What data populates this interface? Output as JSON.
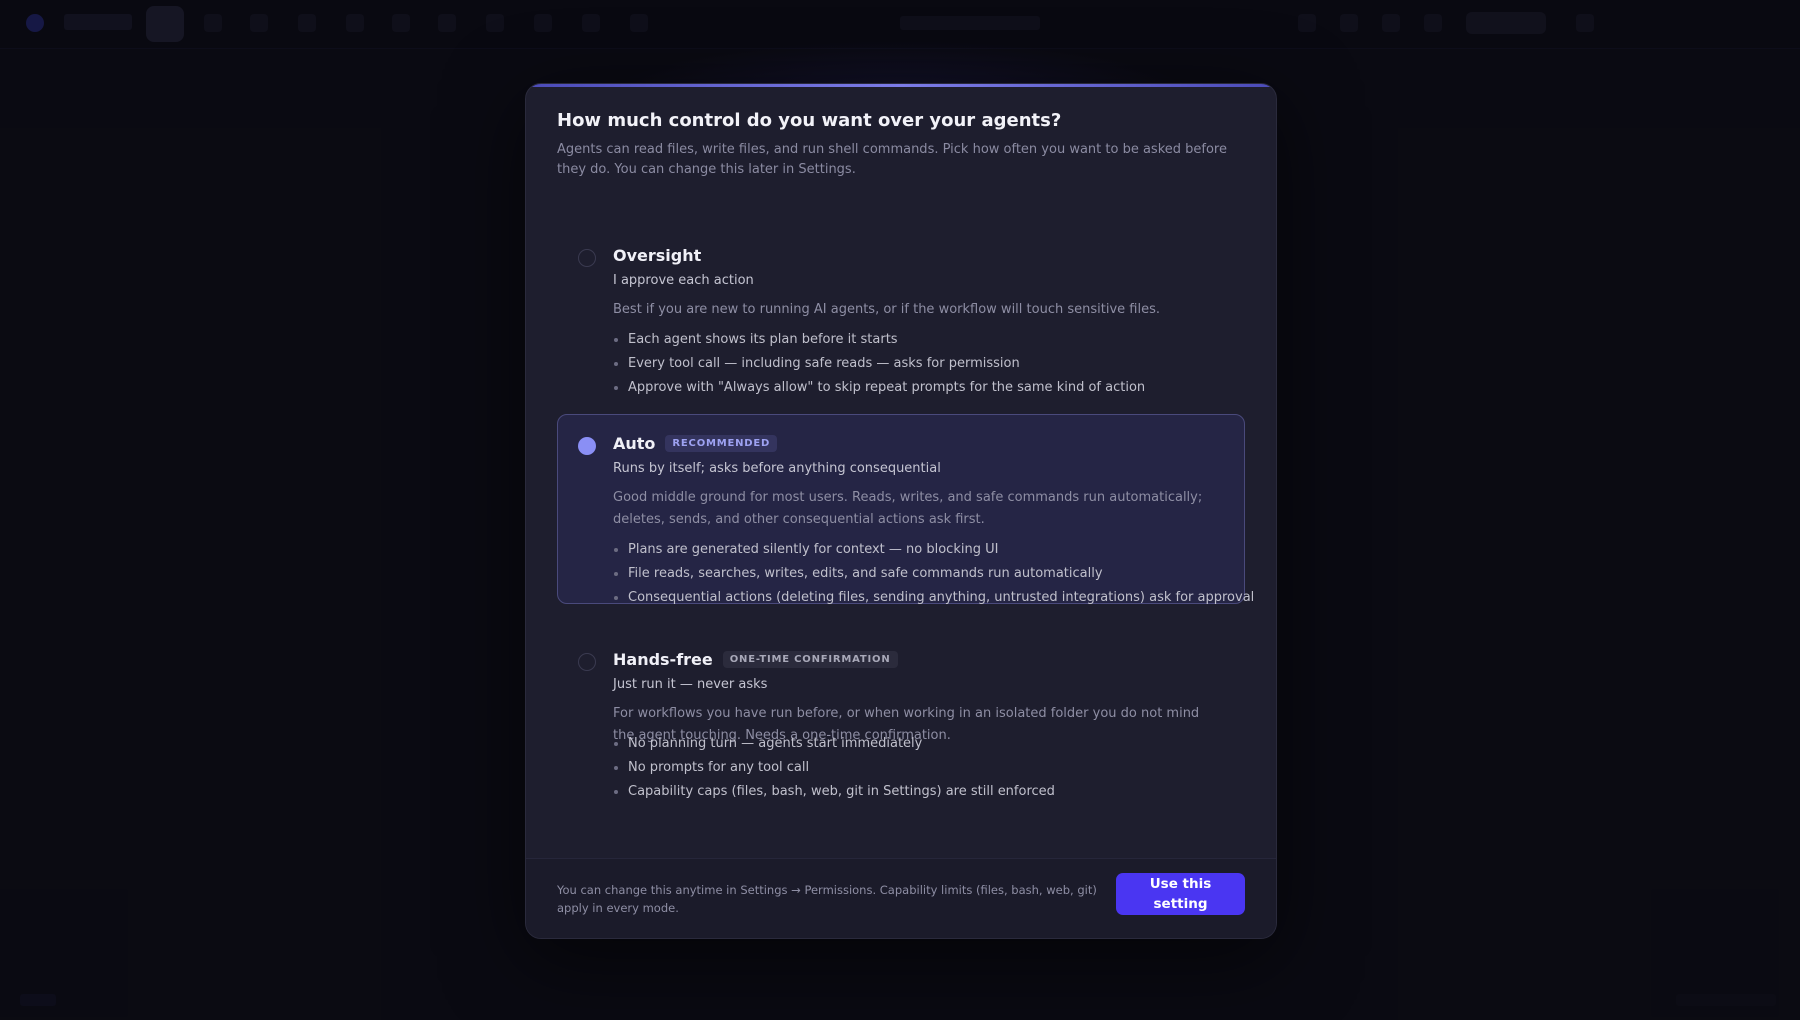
{
  "dialog": {
    "title": "How much control do you want over your agents?",
    "subtitle": "Agents can read files, write files, and run shell commands. Pick how often you want to be asked before they do. You can change this later in Settings."
  },
  "options": [
    {
      "name": "Oversight",
      "badge": "",
      "selected": false,
      "tagline": "I approve each action",
      "description": "Best if you are new to running AI agents, or if the workflow will touch sensitive files.",
      "bullets": [
        "Each agent shows its plan before it starts",
        "Every tool call — including safe reads — asks for permission",
        "Approve with \"Always allow\" to skip repeat prompts for the same kind of action"
      ]
    },
    {
      "name": "Auto",
      "badge": "RECOMMENDED",
      "selected": true,
      "tagline": "Runs by itself; asks before anything consequential",
      "description": "Good middle ground for most users. Reads, writes, and safe commands run automatically; deletes, sends, and other consequential actions ask first.",
      "bullets": [
        "Plans are generated silently for context — no blocking UI",
        "File reads, searches, writes, edits, and safe commands run automatically",
        "Consequential actions (deleting files, sending anything, untrusted integrations) ask for approval"
      ]
    },
    {
      "name": "Hands-free",
      "badge": "ONE-TIME CONFIRMATION",
      "selected": false,
      "tagline": "Just run it — never asks",
      "description": "For workflows you have run before, or when working in an isolated folder you do not mind the agent touching. Needs a one-time confirmation.",
      "bullets": [
        "No planning turn — agents start immediately",
        "No prompts for any tool call",
        "Capability caps (files, bash, web, git in Settings) are still enforced"
      ]
    }
  ],
  "footer": {
    "note": "You can change this anytime in Settings → Permissions. Capability limits (files, bash, web, git) apply in every mode.",
    "primary_label": "Use this setting"
  },
  "colors": {
    "accent": "#4a36f2",
    "selected_radio": "#8a8ff5",
    "badge_recommended": "#9ea2f2"
  }
}
